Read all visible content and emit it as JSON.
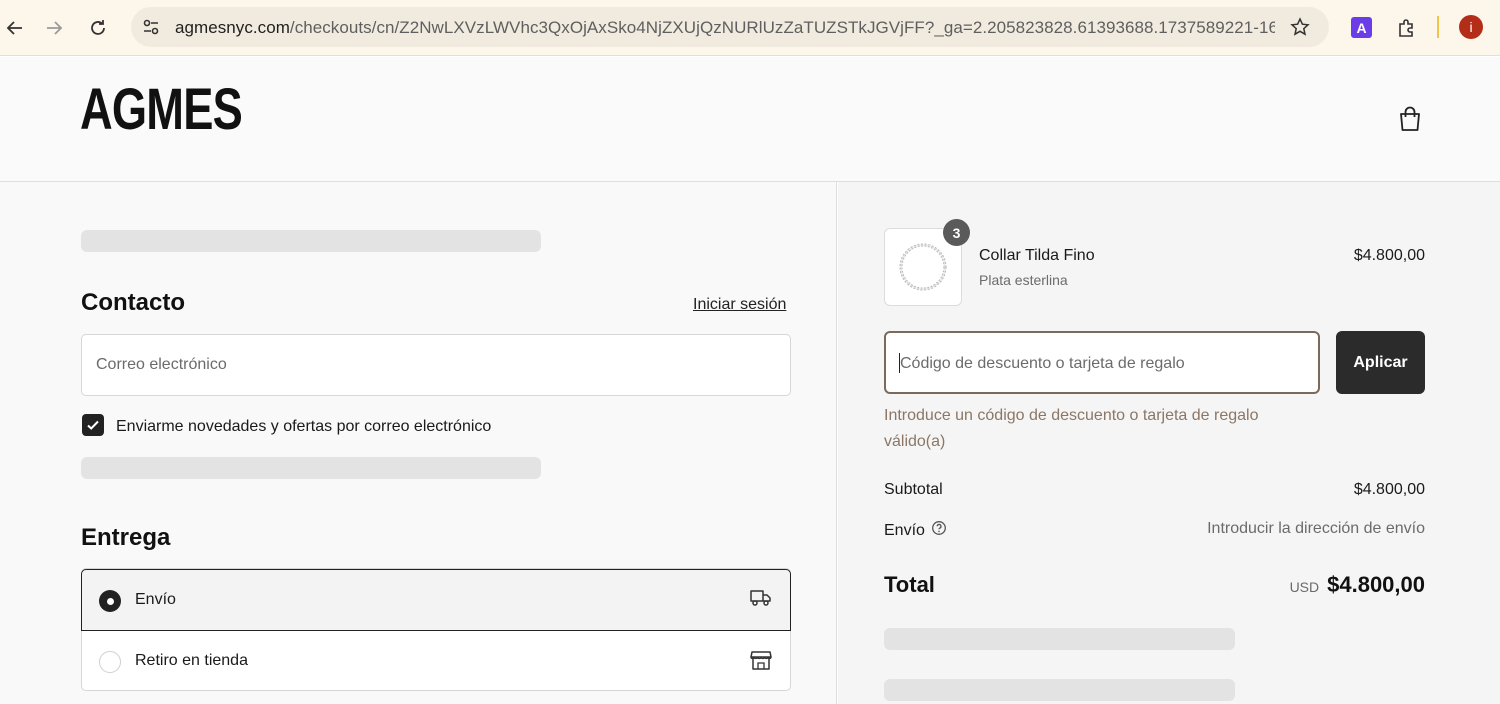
{
  "browser": {
    "url_domain": "agmesnyc.com",
    "url_path": "/checkouts/cn/Z2NwLXVzLWVhc3QxOjAxSko4NjZXUjQzNURlUzZaTUZSTkJGVjFF?_ga=2.205823828.61393688.1737589221-16761...",
    "profile_initial": "i",
    "extension_letter": "A"
  },
  "header": {
    "logo": "AGMES"
  },
  "contact": {
    "heading": "Contacto",
    "login_link": "Iniciar sesión",
    "email_placeholder": "Correo electrónico",
    "newsletter_label": "Enviarme novedades y ofertas por correo electrónico",
    "newsletter_checked": true
  },
  "delivery": {
    "heading": "Entrega",
    "options": [
      {
        "label": "Envío",
        "selected": true,
        "icon": "truck-icon"
      },
      {
        "label": "Retiro en tienda",
        "selected": false,
        "icon": "store-icon"
      }
    ]
  },
  "summary": {
    "product": {
      "name": "Collar Tilda Fino",
      "variant": "Plata esterlina",
      "price": "$4.800,00",
      "quantity": "3"
    },
    "discount_placeholder": "Código de descuento o tarjeta de regalo",
    "apply_label": "Aplicar",
    "error_message": "Introduce un código de descuento o tarjeta de regalo válido(a)",
    "subtotal_label": "Subtotal",
    "subtotal_value": "$4.800,00",
    "shipping_label": "Envío",
    "shipping_value": "Introducir la dirección de envío",
    "total_label": "Total",
    "currency": "USD",
    "total_value": "$4.800,00"
  },
  "colors": {
    "accent_dark": "#2b2b2b",
    "error_text": "#8a7766",
    "chrome_bg": "#fdf6ea"
  }
}
